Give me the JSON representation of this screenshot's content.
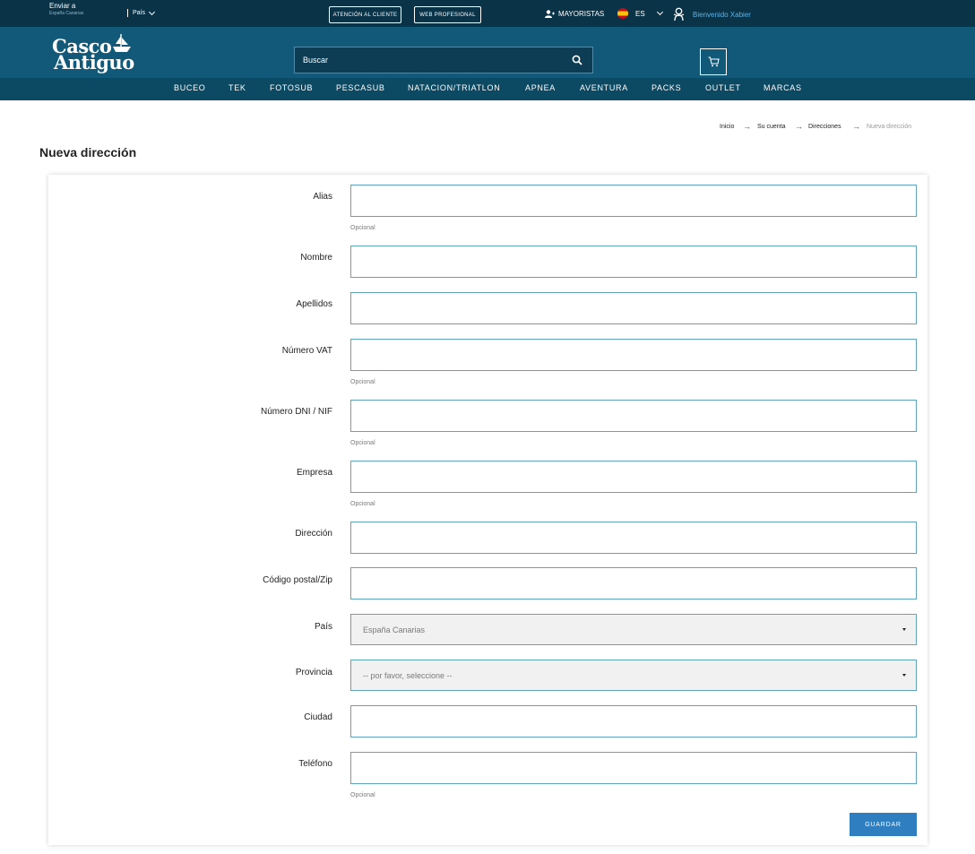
{
  "topbar": {
    "ship_to_label": "Enviar a",
    "ship_to_value": "España Canarias",
    "country_label": "País",
    "customer_service": "ATENCIÓN AL CLIENTE",
    "pro_web": "WEB PROFESIONAL",
    "wholesalers": "MAYORISTAS",
    "language": "ES",
    "welcome": "Bienvenido Xabier"
  },
  "header": {
    "logo_line1": "Casco",
    "logo_line2": "Antiguo",
    "search_placeholder": "Buscar"
  },
  "nav": {
    "items": [
      "BUCEO",
      "TEK",
      "FOTOSUB",
      "PESCASUB",
      "NATACION/TRIATLON",
      "APNEA",
      "AVENTURA",
      "PACKS",
      "OUTLET",
      "MARCAS"
    ]
  },
  "breadcrumb": {
    "items": [
      "Inicio",
      "Su cuenta",
      "Direcciones",
      "Nueva dirección"
    ],
    "separator": "→"
  },
  "page": {
    "title": "Nueva dirección"
  },
  "form": {
    "optional_text": "Opcional",
    "fields": {
      "alias": "Alias",
      "nombre": "Nombre",
      "apellidos": "Apellidos",
      "vat": "Número VAT",
      "dni": "Número DNI / NIF",
      "empresa": "Empresa",
      "direccion": "Dirección",
      "postal": "Código postal/Zip",
      "pais": "País",
      "provincia": "Provincia",
      "ciudad": "Ciudad",
      "telefono": "Teléfono"
    },
    "pais_value": "España Canarias",
    "provincia_value": "-- por favor, seleccione --",
    "save_label": "GUARDAR"
  },
  "colors": {
    "topbar_bg": "#0b3347",
    "header_bg": "#115879",
    "nav_bg": "#0c4963",
    "input_border": "#5fa3bf",
    "primary_button": "#2e7ec0",
    "welcome_link": "#5ab3e6"
  },
  "icons": {
    "search": "search-icon",
    "cart": "cart-icon",
    "wholesalers": "user-plus-icon",
    "language_flag": "spain-flag-icon",
    "account": "user-icon"
  }
}
